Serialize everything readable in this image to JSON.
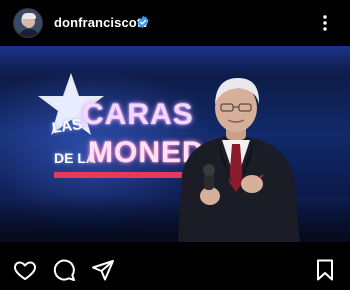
{
  "post": {
    "username": "donfranciscotv",
    "verified": true,
    "image": {
      "logo_small": "LAS",
      "logo_main": "CARAS",
      "logo_small_2": "DE LA",
      "logo_main_2": "MONEDA"
    }
  },
  "icons": {
    "verified": "verified-badge-icon",
    "more": "more-options-icon",
    "like": "heart-icon",
    "comment": "comment-icon",
    "share": "send-icon",
    "save": "bookmark-icon"
  },
  "colors": {
    "background": "#000000",
    "verified": "#3897f0",
    "logo_bar": "#e53b5b"
  }
}
